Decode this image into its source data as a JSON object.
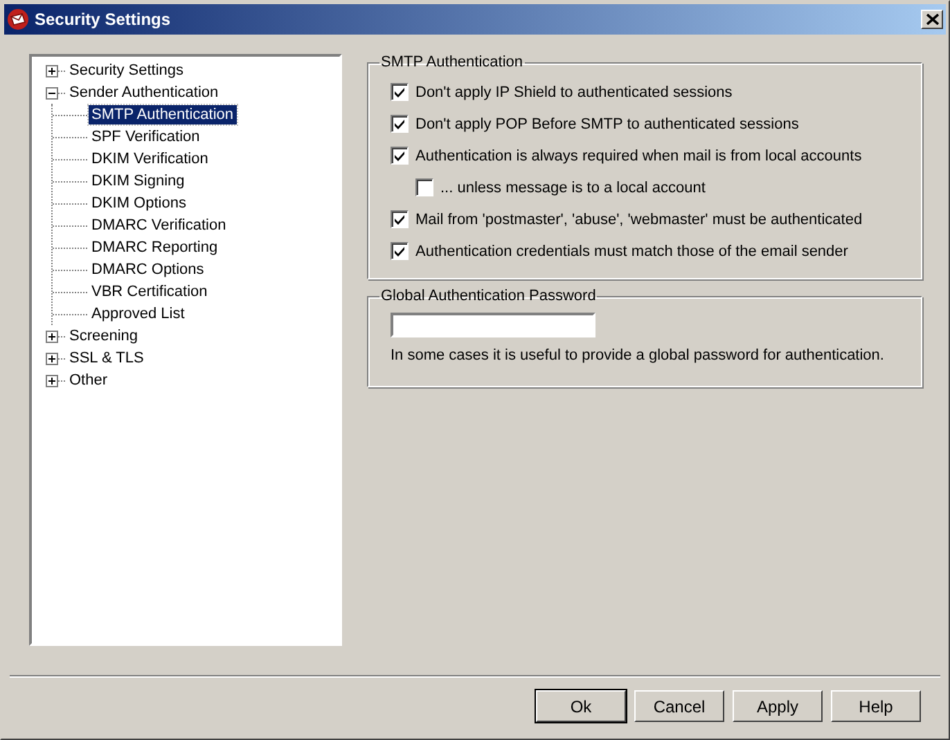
{
  "window": {
    "title": "Security Settings"
  },
  "tree": [
    {
      "label": "Security Settings",
      "expanded": false,
      "selected": false
    },
    {
      "label": "Sender Authentication",
      "expanded": true,
      "selected": false,
      "children": [
        {
          "label": "SMTP Authentication",
          "selected": true
        },
        {
          "label": "SPF Verification",
          "selected": false
        },
        {
          "label": "DKIM Verification",
          "selected": false
        },
        {
          "label": "DKIM Signing",
          "selected": false
        },
        {
          "label": "DKIM Options",
          "selected": false
        },
        {
          "label": "DMARC Verification",
          "selected": false
        },
        {
          "label": "DMARC Reporting",
          "selected": false
        },
        {
          "label": "DMARC Options",
          "selected": false
        },
        {
          "label": "VBR Certification",
          "selected": false
        },
        {
          "label": "Approved List",
          "selected": false
        }
      ]
    },
    {
      "label": "Screening",
      "expanded": false,
      "selected": false
    },
    {
      "label": "SSL & TLS",
      "expanded": false,
      "selected": false
    },
    {
      "label": "Other",
      "expanded": false,
      "selected": false
    }
  ],
  "smtp_group": {
    "title": "SMTP Authentication",
    "options": [
      {
        "label": "Don't apply IP Shield to authenticated sessions",
        "checked": true
      },
      {
        "label": "Don't apply POP Before SMTP to authenticated sessions",
        "checked": true
      },
      {
        "label": "Authentication is always required when mail is from local accounts",
        "checked": true,
        "children": [
          {
            "label": "... unless message is to a local account",
            "checked": false
          }
        ]
      },
      {
        "label": "Mail from 'postmaster', 'abuse', 'webmaster' must be authenticated",
        "checked": true
      },
      {
        "label": "Authentication credentials must match those of the email sender",
        "checked": true
      }
    ]
  },
  "password_group": {
    "title": "Global Authentication Password",
    "note": "In some cases it is useful to provide a global password for authentication."
  },
  "buttons": [
    {
      "label": "Ok",
      "default": true
    },
    {
      "label": "Cancel",
      "default": false
    },
    {
      "label": "Apply",
      "default": false
    },
    {
      "label": "Help",
      "default": false
    }
  ]
}
